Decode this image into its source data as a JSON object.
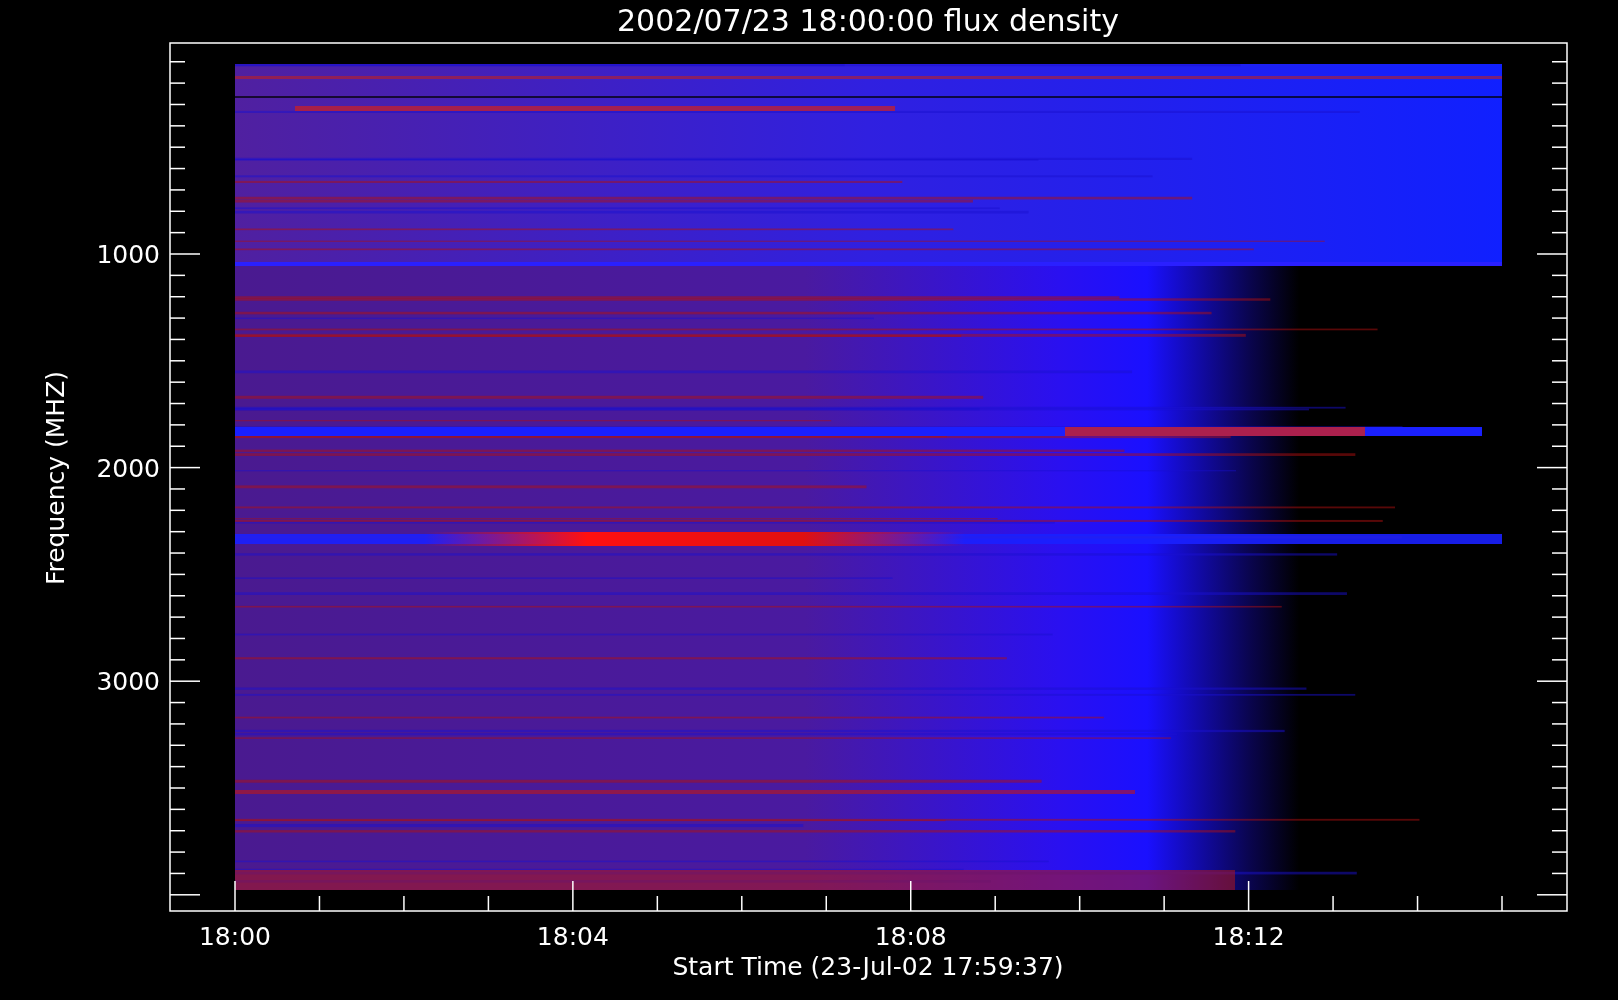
{
  "title": "2002/07/23 18:00:00 flux density",
  "y_axis": {
    "label": "Frequency (MHZ)",
    "tick_labels": [
      "1000",
      "2000",
      "3000"
    ]
  },
  "x_axis": {
    "label": "Start Time (23-Jul-02 17:59:37)",
    "tick_labels": [
      "18:00",
      "18:04",
      "18:08",
      "18:12"
    ]
  }
}
